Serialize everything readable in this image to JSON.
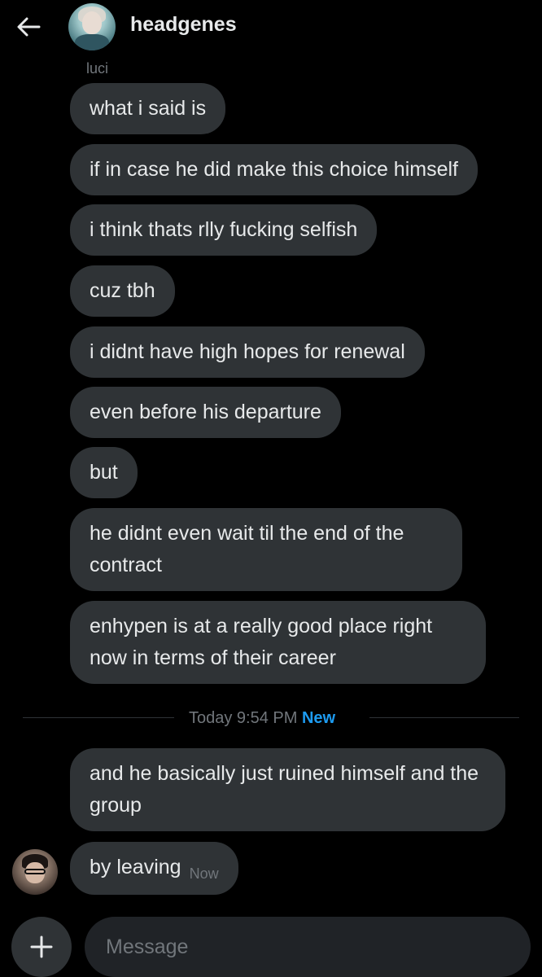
{
  "header": {
    "back_icon": "arrow-left-icon",
    "name": "headgenes"
  },
  "sender": {
    "name": "luci"
  },
  "messages": [
    {
      "text": "what i said is"
    },
    {
      "text": "if in case he did make this choice himself"
    },
    {
      "text": "i think thats rlly fucking selfish"
    },
    {
      "text": "cuz tbh"
    },
    {
      "text": "i didnt have high hopes for renewal"
    },
    {
      "text": "even before his departure"
    },
    {
      "text": "but"
    },
    {
      "text": "he didnt even wait til the end of the contract"
    },
    {
      "text": "enhypen is at a really good place right now in terms of their career"
    }
  ],
  "divider": {
    "label": "Today 9:54 PM",
    "badge": "New"
  },
  "new_messages": [
    {
      "text": "and he basically just ruined himself and the group"
    },
    {
      "text": "by leaving",
      "time": "Now"
    }
  ],
  "composer": {
    "add_icon": "plus-icon",
    "placeholder": "Message"
  },
  "colors": {
    "background": "#000000",
    "bubble": "#2f3336",
    "text": "#e7e9ea",
    "muted": "#71767b",
    "accent": "#1d9bf0"
  }
}
